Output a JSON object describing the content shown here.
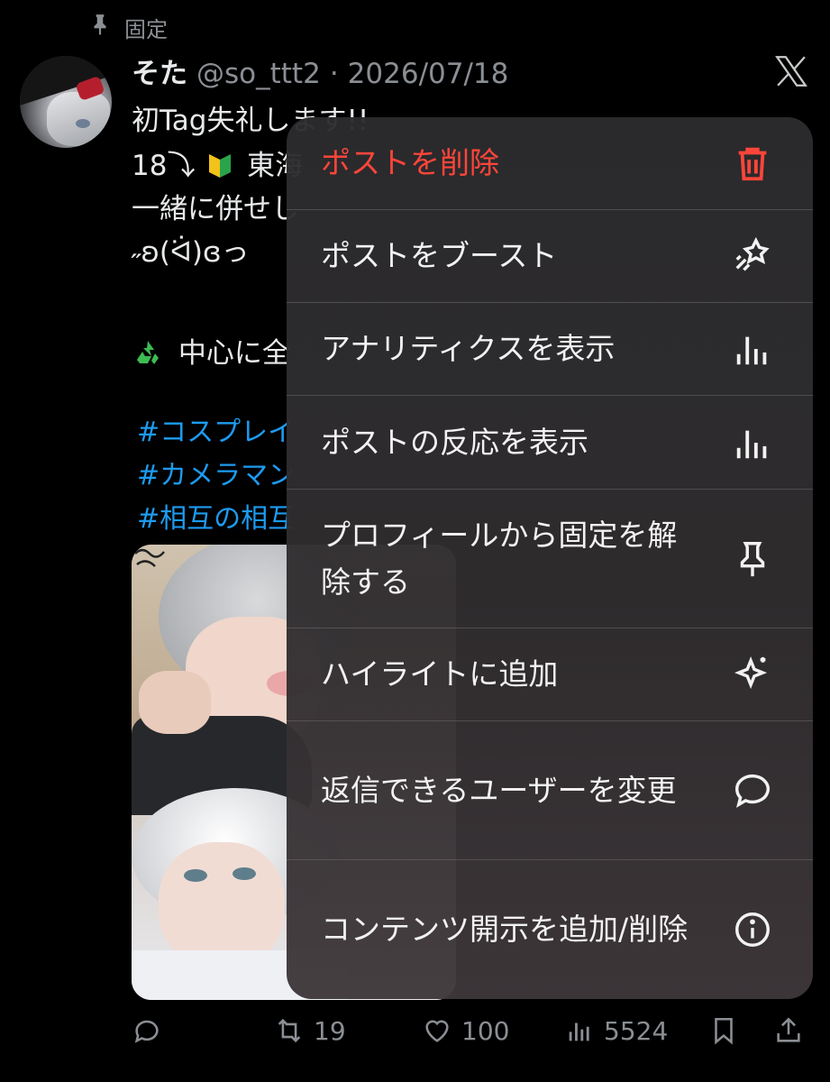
{
  "pinned": {
    "label": "固定"
  },
  "tweet": {
    "display_name": "そた",
    "handle": "@so_ttt2",
    "separator": "·",
    "date": "2026/07/18",
    "lines": [
      "初Tag失礼します!!",
      "18⤵",
      "東海",
      "一緒に併せし",
      "˶ʚ(ᐛ)ɞっ ",
      "中心に全"
    ],
    "hashtags": [
      "#コスプレイ",
      "#カメラマン",
      "#相互の相互"
    ]
  },
  "actions": {
    "replies": "",
    "retweets": "19",
    "likes": "100",
    "views": "5524"
  },
  "menu": {
    "items": [
      {
        "label": "ポストを削除",
        "icon": "trash-icon",
        "danger": true
      },
      {
        "label": "ポストをブースト",
        "icon": "rocket-boost-icon"
      },
      {
        "label": "アナリティクスを表示",
        "icon": "analytics-bars-icon"
      },
      {
        "label": "ポストの反応を表示",
        "icon": "analytics-bars-icon"
      },
      {
        "label": "プロフィールから固定を解除する",
        "icon": "pin-icon"
      },
      {
        "label": "ハイライトに追加",
        "icon": "sparkle-icon"
      },
      {
        "label": "返信できるユーザーを変更",
        "icon": "speech-bubble-icon"
      },
      {
        "label": "コンテンツ開示を追加/削除",
        "icon": "info-icon"
      }
    ]
  },
  "colors": {
    "background": "#000000",
    "text": "#e7e9ea",
    "muted": "#8b8f94",
    "link": "#1d9bf0",
    "danger": "#ff453a"
  }
}
